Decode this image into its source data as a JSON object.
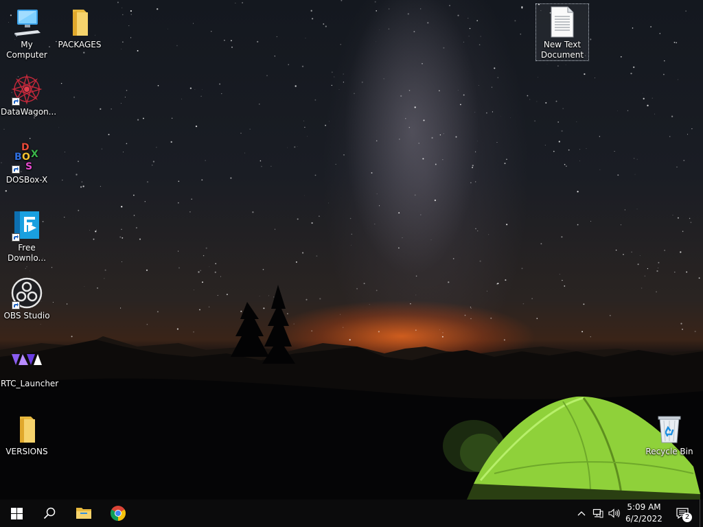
{
  "desktop": {
    "icons": [
      {
        "label": "My Computer",
        "icon": "computer-icon",
        "shortcut": false
      },
      {
        "label": "PACKAGES",
        "icon": "folder-icon",
        "shortcut": false
      },
      {
        "label": "DataWagon...",
        "icon": "datawagon-icon",
        "shortcut": true
      },
      {
        "label": "DOSBox-X",
        "icon": "dosbox-icon",
        "shortcut": true
      },
      {
        "label": "Free Downlo...",
        "icon": "free-download-manager-icon",
        "shortcut": true
      },
      {
        "label": "OBS Studio",
        "icon": "obs-studio-icon",
        "shortcut": true
      },
      {
        "label": "RTC_Launcher",
        "icon": "rtc-launcher-icon",
        "shortcut": false
      },
      {
        "label": "VERSIONS",
        "icon": "folder-icon",
        "shortcut": false
      },
      {
        "label": "New Text Document",
        "icon": "text-document-icon",
        "shortcut": false,
        "selected": true
      },
      {
        "label": "Recycle Bin",
        "icon": "recycle-bin-icon",
        "shortcut": false
      }
    ]
  },
  "taskbar": {
    "start": "windows-start-icon",
    "search": "search-icon",
    "pinned": [
      {
        "name": "File Explorer",
        "icon": "file-explorer-icon"
      },
      {
        "name": "Google Chrome",
        "icon": "chrome-icon"
      }
    ],
    "tray_icons": [
      "chevron-up-icon",
      "network-icon",
      "volume-icon"
    ],
    "clock": {
      "time": "5:09 AM",
      "date": "6/2/2022"
    },
    "notifications": {
      "icon": "action-center-icon",
      "count": "2"
    }
  },
  "colors": {
    "taskbar": "#0b0b0c",
    "tent": "#8fd13a",
    "horizon_glow": "#ff6e1e"
  }
}
